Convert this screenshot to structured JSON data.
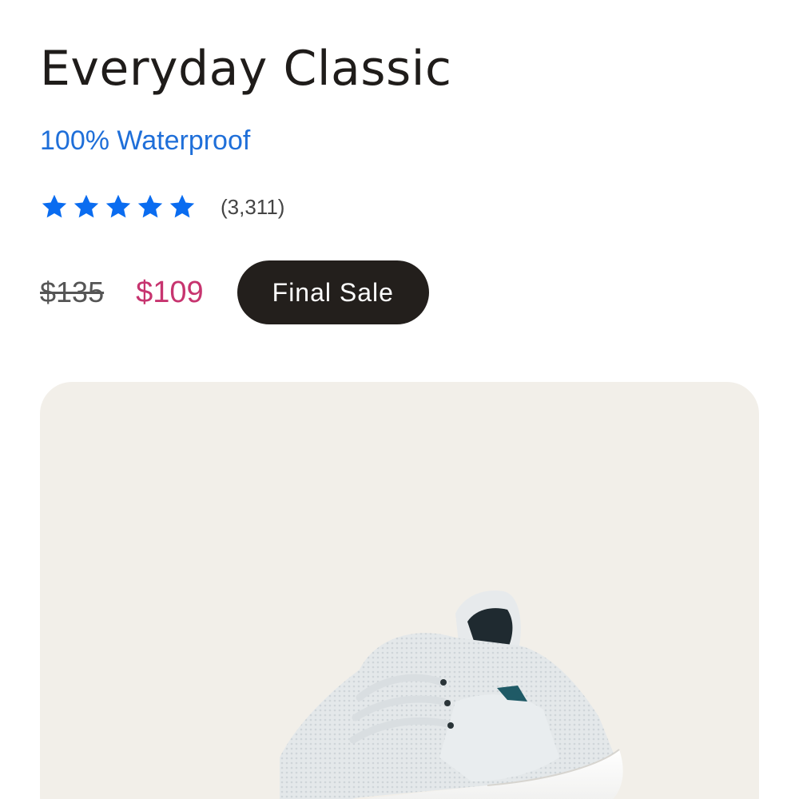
{
  "product": {
    "title": "Everyday Classic",
    "subtitle": "100% Waterproof",
    "rating": {
      "stars": 5,
      "review_count": "(3,311)",
      "star_color": "#0a6cf0"
    },
    "price": {
      "original": "$135",
      "sale": "$109",
      "sale_color": "#c7346f"
    },
    "badge": "Final Sale",
    "image": {
      "icon": "sneaker-image",
      "background": "#f2efe9"
    }
  }
}
